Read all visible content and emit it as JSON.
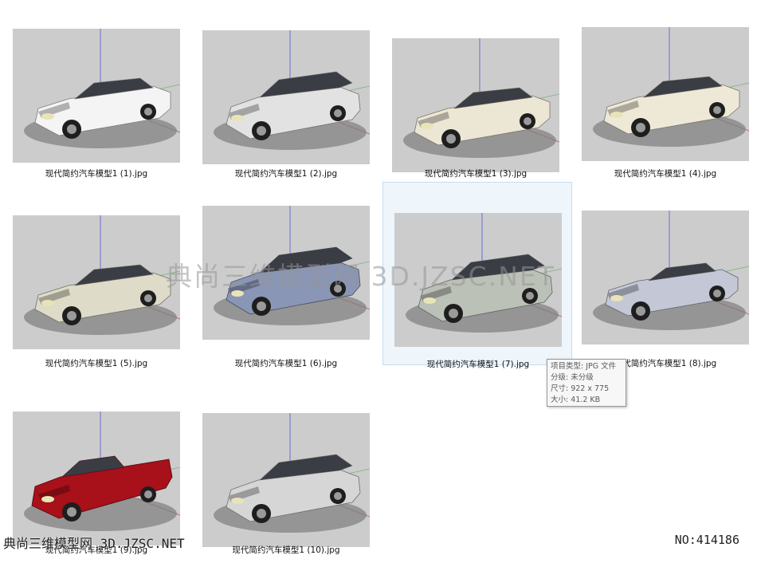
{
  "files": [
    {
      "name": "现代简约汽车模型1 (1).jpg",
      "car": "sedan",
      "color": "#f4f4f4"
    },
    {
      "name": "现代简约汽车模型1 (2).jpg",
      "car": "suv",
      "color": "#e2e2e2"
    },
    {
      "name": "现代简约汽车模型1 (3).jpg",
      "car": "sedan",
      "color": "#ece6d4"
    },
    {
      "name": "现代简约汽车模型1 (4).jpg",
      "car": "sedan",
      "color": "#eee9d6"
    },
    {
      "name": "现代简约汽车模型1 (5).jpg",
      "car": "sedan",
      "color": "#dedbc8"
    },
    {
      "name": "现代简约汽车模型1 (6).jpg",
      "car": "wagon",
      "color": "#8a96b6"
    },
    {
      "name": "现代简约汽车模型1 (7).jpg",
      "car": "wagon",
      "color": "#bcc1b8"
    },
    {
      "name": "现代简约汽车模型1 (8).jpg",
      "car": "coupe",
      "color": "#c4c7d6"
    },
    {
      "name": "现代简约汽车模型1 (9).jpg",
      "car": "truck",
      "color": "#a8101a"
    },
    {
      "name": "现代简约汽车模型1 (10).jpg",
      "car": "suv",
      "color": "#d6d6d6"
    }
  ],
  "selected_index": 6,
  "tooltip": {
    "type": "项目类型: JPG 文件",
    "rating": "分级: 未分级",
    "dimensions": "尺寸: 922 x 775",
    "size": "大小: 41.2 KB"
  },
  "watermark": {
    "center": "典尚三维模型网 3D.JZSC.NET",
    "bottom_left": "典尚三维模型网 3D.JZSC.NET",
    "bottom_right": "NO:414186"
  }
}
